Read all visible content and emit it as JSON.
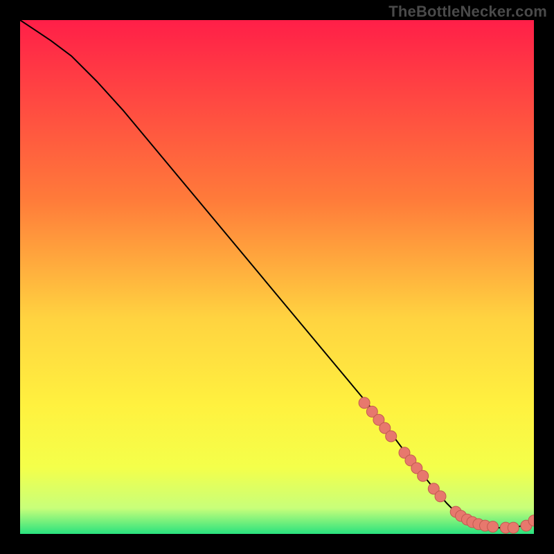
{
  "watermark": "TheBottleNecker.com",
  "colors": {
    "gradient_top": "#ff1f48",
    "gradient_mid1": "#ff7b3a",
    "gradient_mid2": "#ffd340",
    "gradient_mid3": "#fff13f",
    "gradient_mid4": "#f4ff4a",
    "gradient_mid5": "#c8ff7a",
    "gradient_bottom": "#29e27e",
    "curve": "#000000",
    "marker_fill": "#e7786d",
    "marker_stroke": "#c25a50"
  },
  "chart_data": {
    "type": "line",
    "title": "",
    "xlabel": "",
    "ylabel": "",
    "xlim": [
      0,
      100
    ],
    "ylim": [
      0,
      100
    ],
    "grid": false,
    "legend": false,
    "series": [
      {
        "name": "bottleneck-curve",
        "x": [
          0,
          3,
          6,
          10,
          15,
          20,
          25,
          30,
          35,
          40,
          45,
          50,
          55,
          60,
          65,
          70,
          73,
          76,
          80,
          83,
          85,
          87,
          89,
          91,
          93,
          95,
          97,
          99,
          100
        ],
        "y": [
          100,
          98,
          96,
          93,
          88,
          82.5,
          76.5,
          70.5,
          64.5,
          58.5,
          52.5,
          46.5,
          40.5,
          34.5,
          28.5,
          22.5,
          18.5,
          14.5,
          9.5,
          6.0,
          4.0,
          2.6,
          1.8,
          1.4,
          1.2,
          1.2,
          1.4,
          2.0,
          2.6
        ]
      }
    ],
    "markers": {
      "name": "highlight-points",
      "x": [
        67,
        68.5,
        69.8,
        71,
        72.2,
        74.8,
        76,
        77.2,
        78.4,
        80.5,
        81.8,
        84.8,
        85.8,
        87,
        88,
        89.2,
        90.5,
        92,
        94.5,
        96,
        98.5,
        100
      ],
      "y": [
        25.5,
        23.8,
        22.2,
        20.6,
        19.0,
        15.8,
        14.3,
        12.8,
        11.3,
        8.8,
        7.3,
        4.3,
        3.5,
        2.8,
        2.3,
        1.9,
        1.6,
        1.4,
        1.2,
        1.2,
        1.6,
        2.6
      ]
    }
  }
}
